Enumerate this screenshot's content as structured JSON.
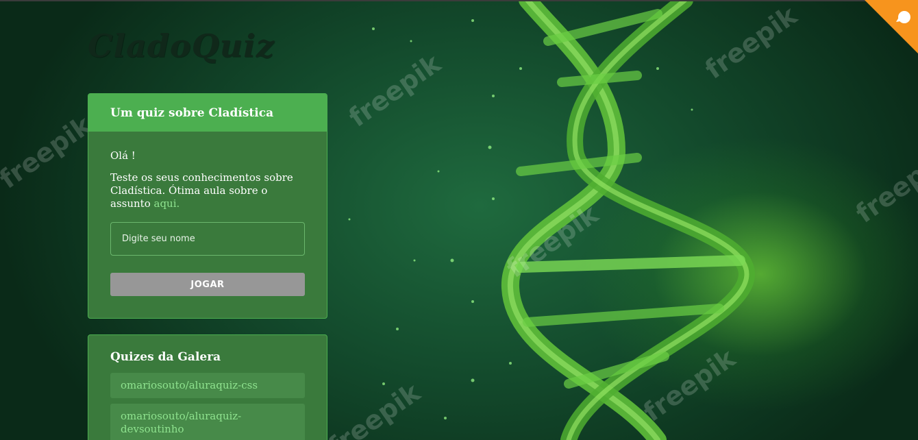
{
  "logo": {
    "text": "CladoQuiz"
  },
  "main_widget": {
    "title": "Um quiz sobre Cladística",
    "greeting": "Olá !",
    "description": "Teste os seus conhecimentos sobre Cladística. Ótima aula sobre o assunto ",
    "link_text": "aqui.",
    "input_placeholder": "Digite seu nome",
    "play_button": "JOGAR"
  },
  "community_widget": {
    "title": "Quizes da Galera",
    "links": [
      "omariosouto/aluraquiz-css",
      "omariosouto/aluraquiz-devsoutinho"
    ]
  },
  "watermark_text": "freepik",
  "colors": {
    "widget_bg": "#3a7a3c",
    "widget_header": "#4caf50",
    "button_disabled": "#979797",
    "link": "#8fe38f",
    "corner_ribbon": "#f7941d"
  }
}
